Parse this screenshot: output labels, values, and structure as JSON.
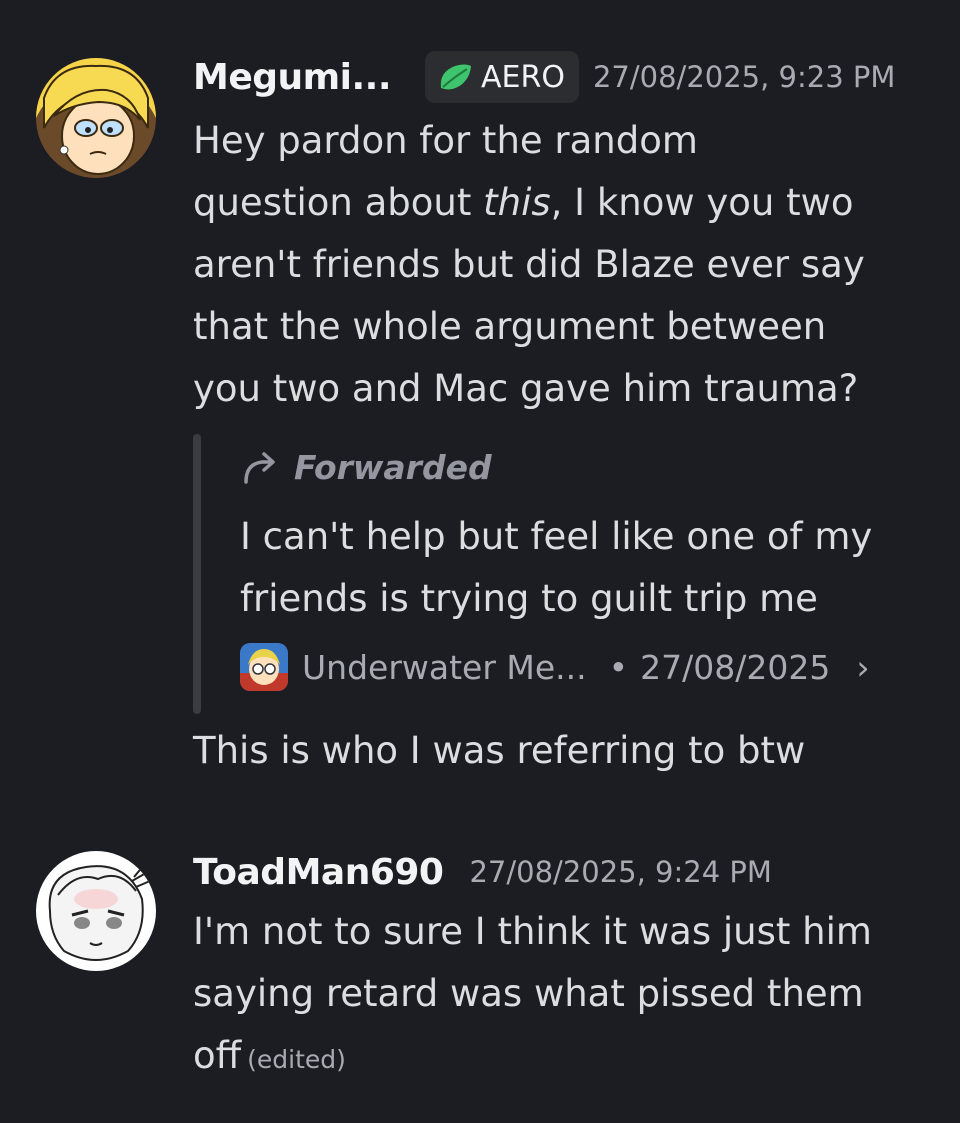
{
  "messages": [
    {
      "username": "Megumi...",
      "tag": {
        "label": "AERO",
        "icon": "leaf-icon",
        "color": "#3ec46d"
      },
      "timestamp": "27/08/2025, 9:23 PM",
      "text": {
        "part1": "Hey pardon for the random",
        "part2_prefix": "question about ",
        "part2_italic": "this",
        "part2_suffix": ", I know you two",
        "part3": "aren't friends but did Blaze ever say",
        "part4": "that the whole argument between",
        "part5": "you two and Mac gave him trauma?"
      },
      "forwarded": {
        "label": "Forwarded",
        "icon": "forward-arrow-icon",
        "line1": "I can't help but feel like one of my",
        "line2": "friends is trying to guilt trip me",
        "source_name": "Underwater Me...",
        "separator": "•",
        "source_date": "27/08/2025",
        "chevron": "›"
      },
      "after_text": "This is who I was referring to btw"
    },
    {
      "username": "ToadMan690",
      "timestamp": "27/08/2025, 9:24 PM",
      "text": {
        "line1": "I'm not to sure I think it was just him",
        "line2": "saying retard was what pissed them",
        "line3": "off"
      },
      "edited": "(edited)"
    }
  ],
  "colors": {
    "background": "#1c1d22",
    "text": "#dbdee1",
    "muted": "#a9abb3",
    "tag_bg": "#2b2d31"
  }
}
